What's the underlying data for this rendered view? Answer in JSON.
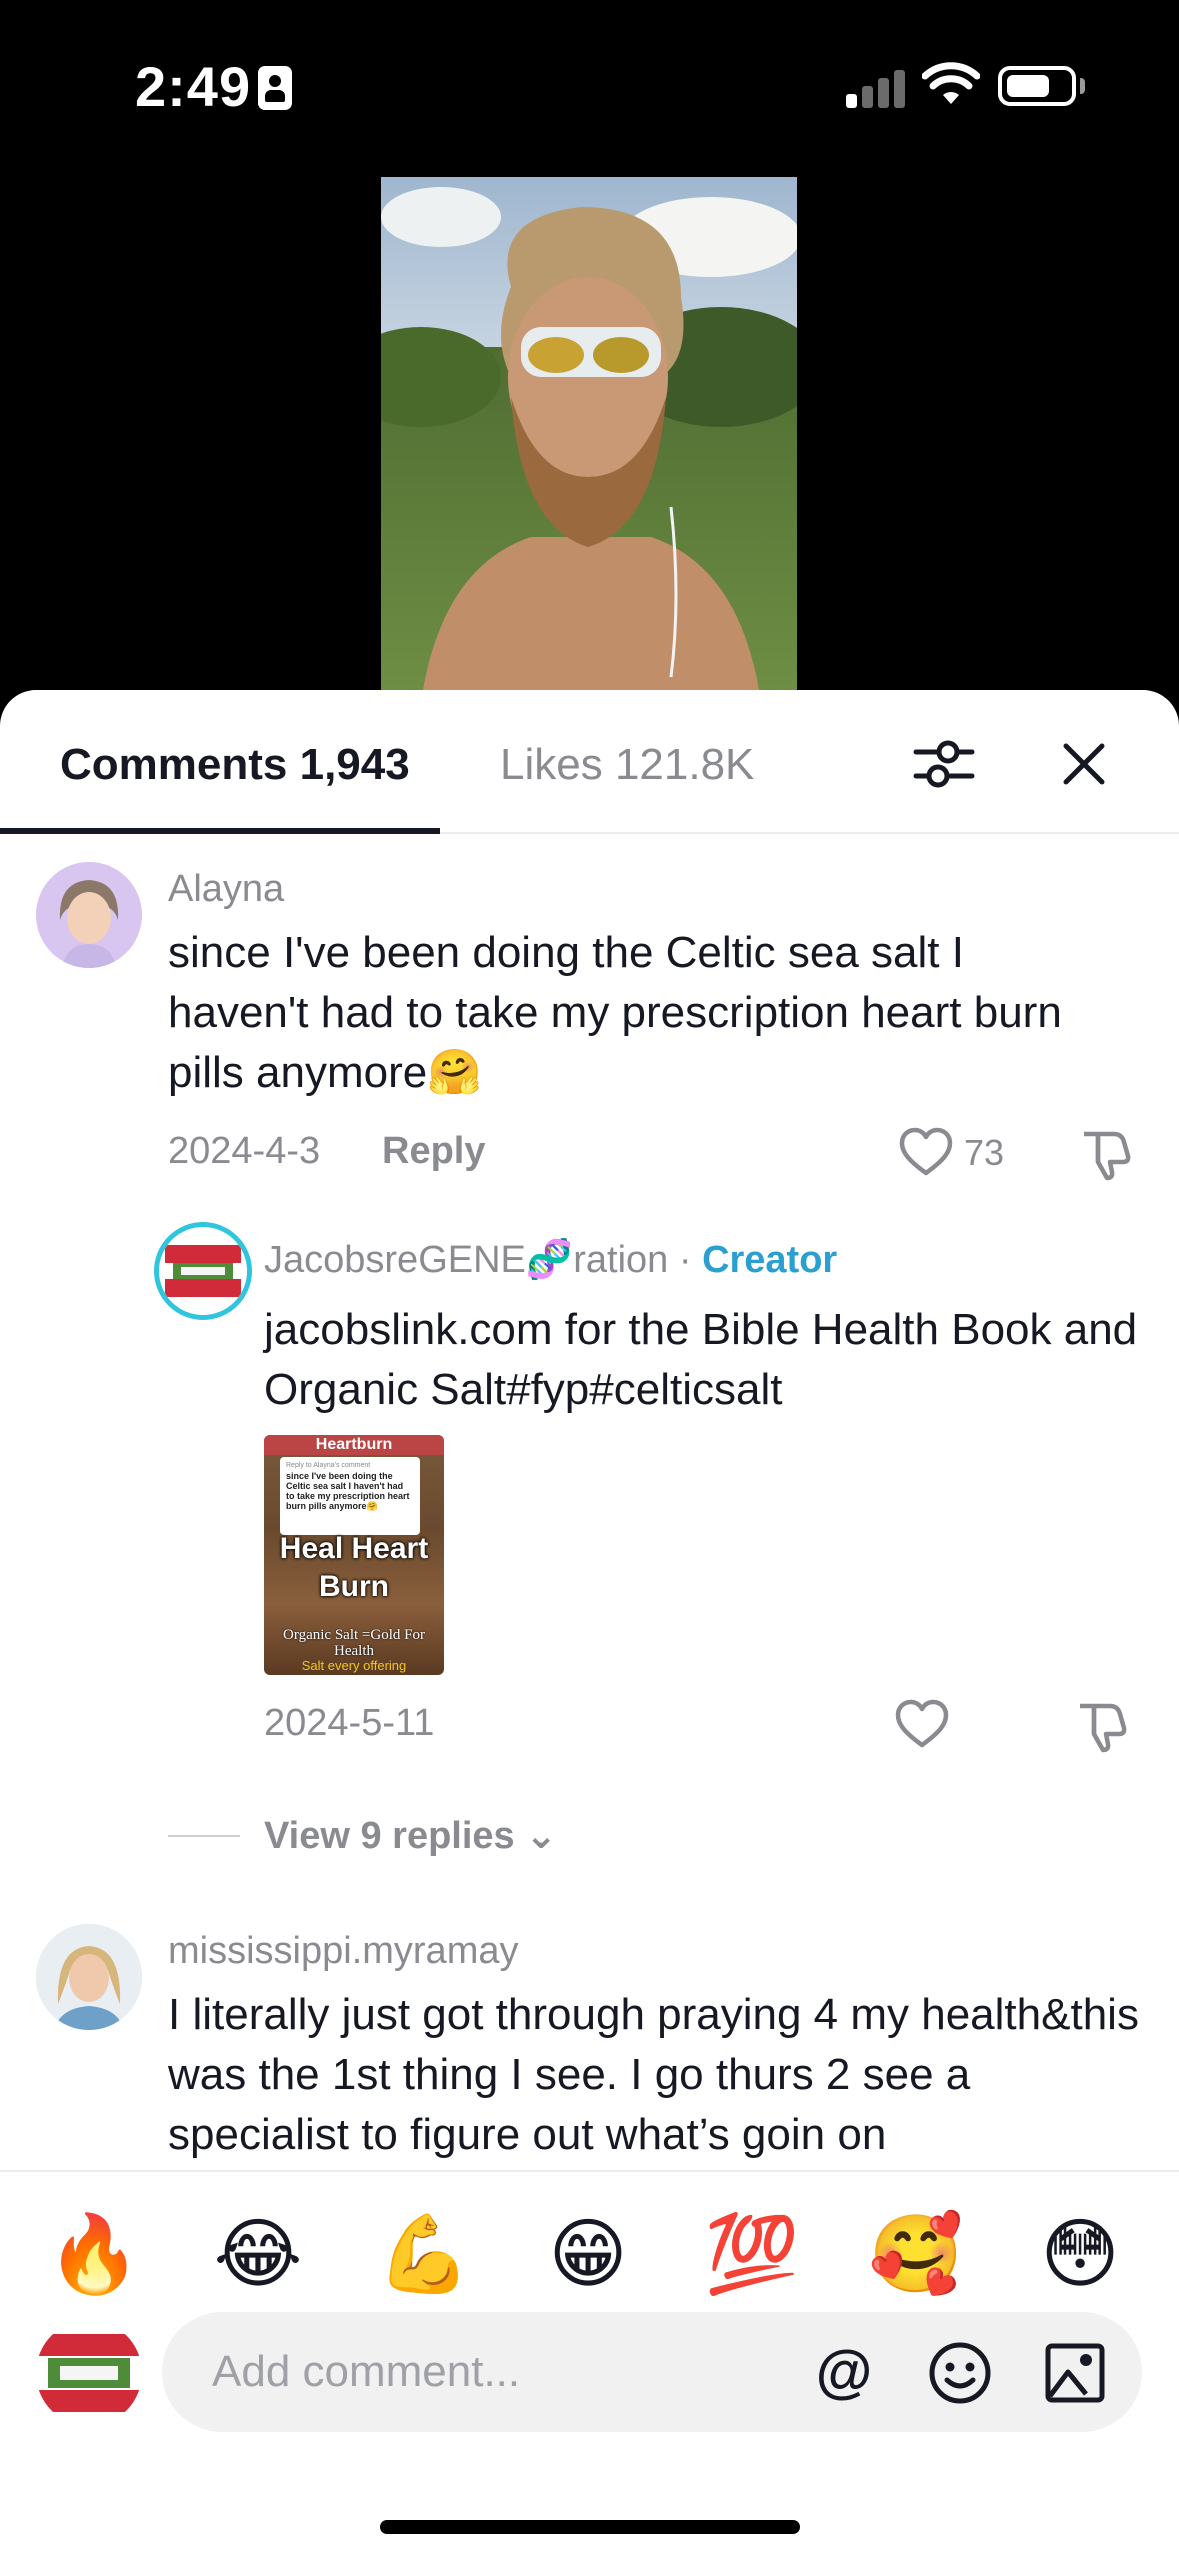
{
  "status_bar": {
    "time": "2:49",
    "icons": [
      "person-id-icon",
      "signal-icon",
      "wifi-icon",
      "battery-icon"
    ]
  },
  "tabs": {
    "comments_label": "Comments 1,943",
    "likes_label": "Likes 121.8K"
  },
  "comments": [
    {
      "username": "Alayna",
      "text": "since I've been doing the Celtic sea salt I haven't had to take my prescription heart burn pills anymore🤗",
      "date": "2024-4-3",
      "reply_label": "Reply",
      "likes": "73"
    },
    {
      "username_prefix": "JacobsreGENE",
      "username_emoji": "🧬",
      "username_suffix": "ration",
      "separator": " · ",
      "badge": "Creator",
      "text": "jacobslink.com for the Bible Health Book and Organic Salt#fyp#celticsalt",
      "date": "2024-5-11",
      "video_thumbnail": {
        "top_label": "Heartburn",
        "reply_to": "Reply to Alayna's comment",
        "card_text": "since I've been doing the Celtic sea salt I haven't had to take my prescription heart burn pills anymore🤗",
        "heading": "Heal Heart Burn",
        "bottom_text": "Organic Salt =Gold For Health",
        "bottom_sub": "Salt every offering"
      }
    },
    {
      "username": "mississippi.myramay",
      "text": "I literally just got through praying 4 my health&this was the 1st thing I see. I go thurs 2 see a specialist to figure out what’s goin on"
    }
  ],
  "view_replies": "View 9 replies ⌄",
  "quick_emojis": [
    "🔥",
    "😂",
    "💪",
    "😁",
    "💯",
    "🥰",
    "😳"
  ],
  "comment_input": {
    "placeholder": "Add comment...",
    "value": "",
    "mention_label": "@"
  }
}
